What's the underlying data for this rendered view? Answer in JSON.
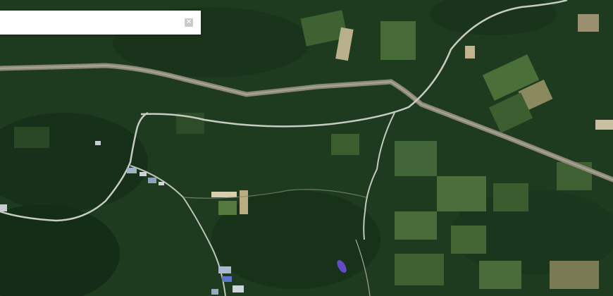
{
  "search": {
    "value": "",
    "placeholder": "",
    "clear_icon": "close-icon",
    "clear_glyph": "✕"
  },
  "map": {
    "view": "satellite",
    "colors": {
      "forest": "#1f3d20",
      "field_light": "#4d6b3a",
      "highway": "#8c8a7c",
      "road": "#c9cfc8",
      "marker": "#6a4fd8"
    }
  }
}
